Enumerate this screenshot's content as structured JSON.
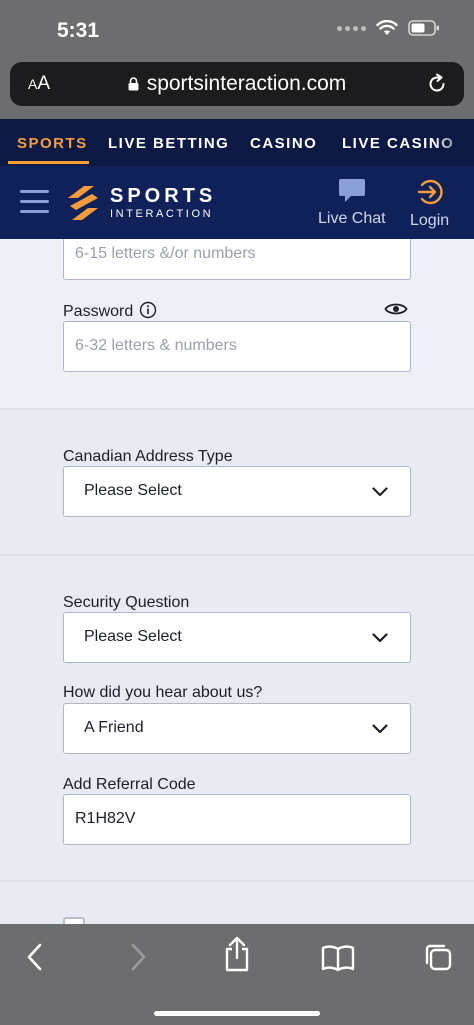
{
  "status_bar": {
    "time": "5:31"
  },
  "browser": {
    "text_size_label_small": "A",
    "text_size_label_large": "A",
    "url": "sportsinteraction.com"
  },
  "nav_tabs": [
    {
      "label": "SPORTS",
      "active": true
    },
    {
      "label": "LIVE BETTING",
      "active": false
    },
    {
      "label": "CASINO",
      "active": false
    },
    {
      "label": "LIVE CASINO",
      "active": false
    }
  ],
  "header": {
    "brand_line1": "SPORTS",
    "brand_line2": "INTERACTION",
    "live_chat_label": "Live Chat",
    "login_label": "Login"
  },
  "form": {
    "username_placeholder": "6-15 letters &/or numbers",
    "password_label": "Password",
    "password_placeholder": "6-32 letters & numbers",
    "address_type_label": "Canadian Address Type",
    "address_type_value": "Please Select",
    "security_question_label": "Security Question",
    "security_question_value": "Please Select",
    "hear_about_label": "How did you hear about us?",
    "hear_about_value": "A Friend",
    "referral_label": "Add Referral Code",
    "referral_value": "R1H82V"
  },
  "colors": {
    "accent": "#f59d3d",
    "nav_bg": "#0c1a43",
    "header_bg": "#0f2158",
    "page_bg": "#e9ebf2"
  }
}
